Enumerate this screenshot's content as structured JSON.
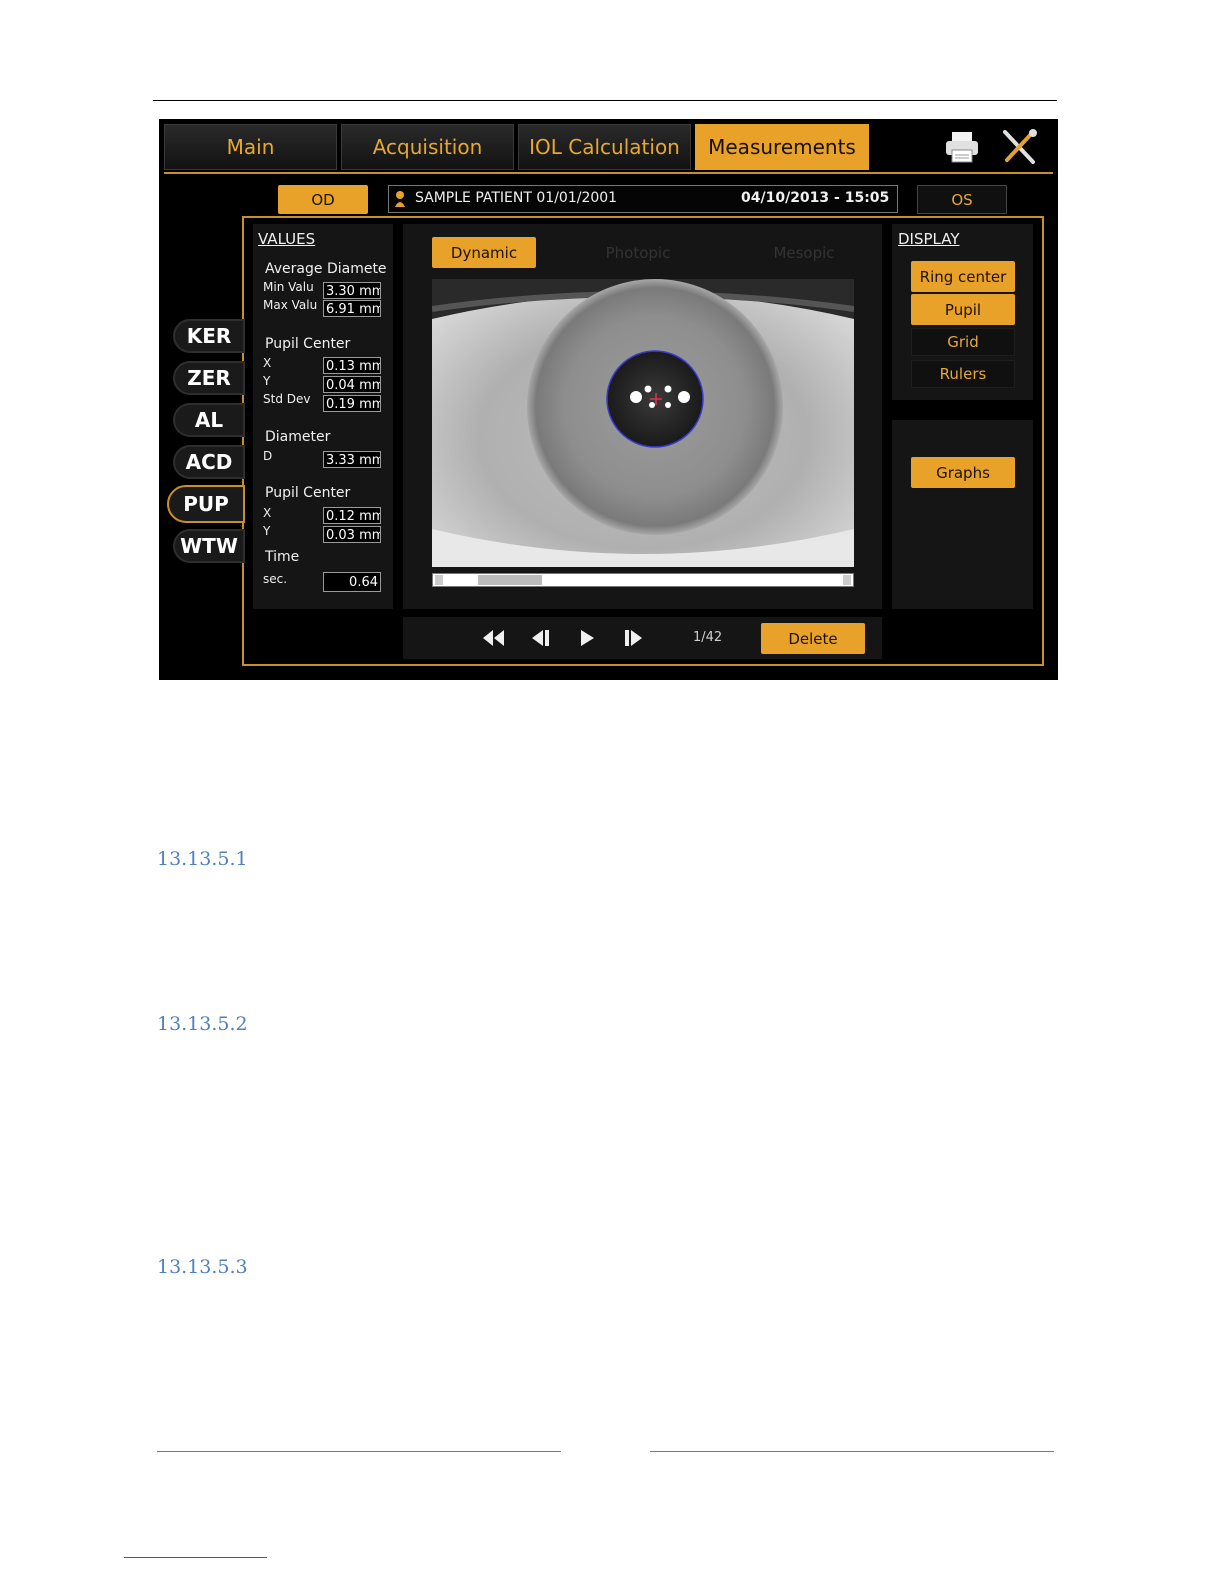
{
  "tabs": [
    {
      "label": "Main"
    },
    {
      "label": "Acquisition"
    },
    {
      "label": "IOL Calculation"
    },
    {
      "label": "Measurements"
    }
  ],
  "eyes": {
    "od": "OD",
    "os": "OS"
  },
  "patient": {
    "name": "SAMPLE PATIENT 01/01/2001",
    "datetime": "04/10/2013 - 15:05"
  },
  "side_tabs": [
    {
      "label": "KER"
    },
    {
      "label": "ZER"
    },
    {
      "label": "AL"
    },
    {
      "label": "ACD"
    },
    {
      "label": "PUP"
    },
    {
      "label": "WTW"
    }
  ],
  "values": {
    "title": "VALUES",
    "avg_diameter": "Average Diamete",
    "min_label": "Min Valu",
    "min_value": "3.30 mm",
    "max_label": "Max Valu",
    "max_value": "6.91 mm",
    "pupil_center_1": "Pupil Center",
    "x_label": "X",
    "x1_value": "0.13 mm",
    "y_label": "Y",
    "y1_value": "0.04 mm",
    "std_label": "Std Dev",
    "std_value": "0.19 mm",
    "diameter": "Diameter",
    "d_label": "D",
    "d_value": "3.33 mm",
    "pupil_center_2": "Pupil Center",
    "x2_value": "0.12 mm",
    "y2_value": "0.03 mm",
    "time": "Time",
    "sec_label": "sec.",
    "sec_value": "0.64"
  },
  "modes": {
    "dynamic": "Dynamic",
    "photopic": "Photopic",
    "mesopic": "Mesopic"
  },
  "display": {
    "title": "DISPLAY",
    "ring_center": "Ring center",
    "pupil": "Pupil",
    "grid": "Grid",
    "rulers": "Rulers",
    "graphs": "Graphs"
  },
  "playback": {
    "frame": "1/42",
    "delete": "Delete",
    "slider_position": 0.1
  },
  "sections": [
    "13.13.5.1",
    "13.13.5.2",
    "13.13.5.3"
  ],
  "colors": {
    "accent": "#e8a22a",
    "heading": "#4f81bd"
  }
}
